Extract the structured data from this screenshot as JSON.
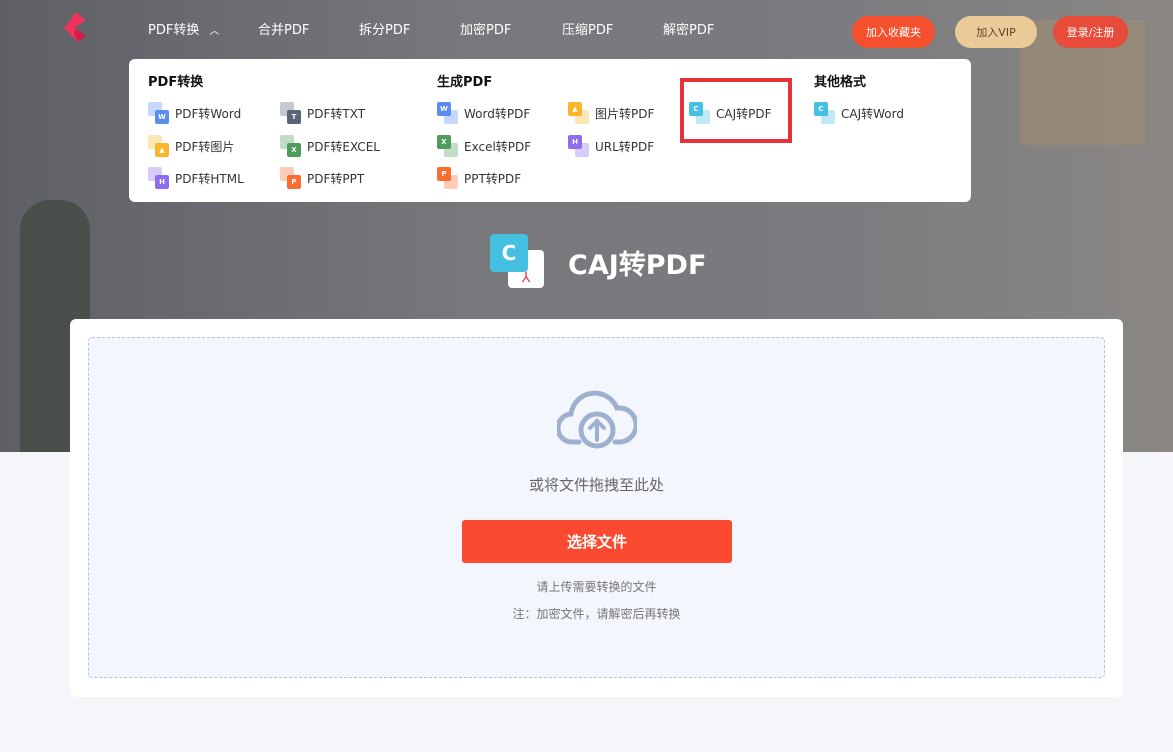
{
  "nav": {
    "items": [
      "PDF转换",
      "合并PDF",
      "拆分PDF",
      "加密PDF",
      "压缩PDF",
      "解密PDF"
    ],
    "bookmark": "加入收藏夹",
    "vip": "加入VIP",
    "login": "登录/注册"
  },
  "menu": {
    "col1_title": "PDF转换",
    "col1": [
      {
        "label": "PDF转Word",
        "badge": "W",
        "color": "#5b8def"
      },
      {
        "label": "PDF转TXT",
        "badge": "T",
        "color": "#5a6478"
      },
      {
        "label": "PDF转图片",
        "badge": "img",
        "color": "#f9b62a"
      },
      {
        "label": "PDF转EXCEL",
        "badge": "X",
        "color": "#4f9d5b"
      },
      {
        "label": "PDF转HTML",
        "badge": "H",
        "color": "#8b6ff0"
      },
      {
        "label": "PDF转PPT",
        "badge": "P",
        "color": "#fb6c33"
      }
    ],
    "col2_title": "生成PDF",
    "col2": [
      {
        "label": "Word转PDF",
        "badge": "W",
        "color": "#5b8def"
      },
      {
        "label": "图片转PDF",
        "badge": "img",
        "color": "#f9b62a"
      },
      {
        "label": "Excel转PDF",
        "badge": "X",
        "color": "#4f9d5b"
      },
      {
        "label": "URL转PDF",
        "badge": "H",
        "color": "#8b6ff0"
      },
      {
        "label": "PPT转PDF",
        "badge": "P",
        "color": "#fb6c33"
      },
      {
        "label": "CAJ转PDF",
        "badge": "C",
        "color": "#46c0e0"
      }
    ],
    "col3_title": "其他格式",
    "col3": [
      {
        "label": "CAJ转Word",
        "badge": "C",
        "color": "#46c0e0"
      }
    ]
  },
  "page": {
    "title": "CAJ转PDF",
    "badge": "C"
  },
  "upload": {
    "drag_text": "或将文件拖拽至此处",
    "select_button": "选择文件",
    "hint": "请上传需要转换的文件",
    "note": "注：加密文件，请解密后再转换"
  }
}
